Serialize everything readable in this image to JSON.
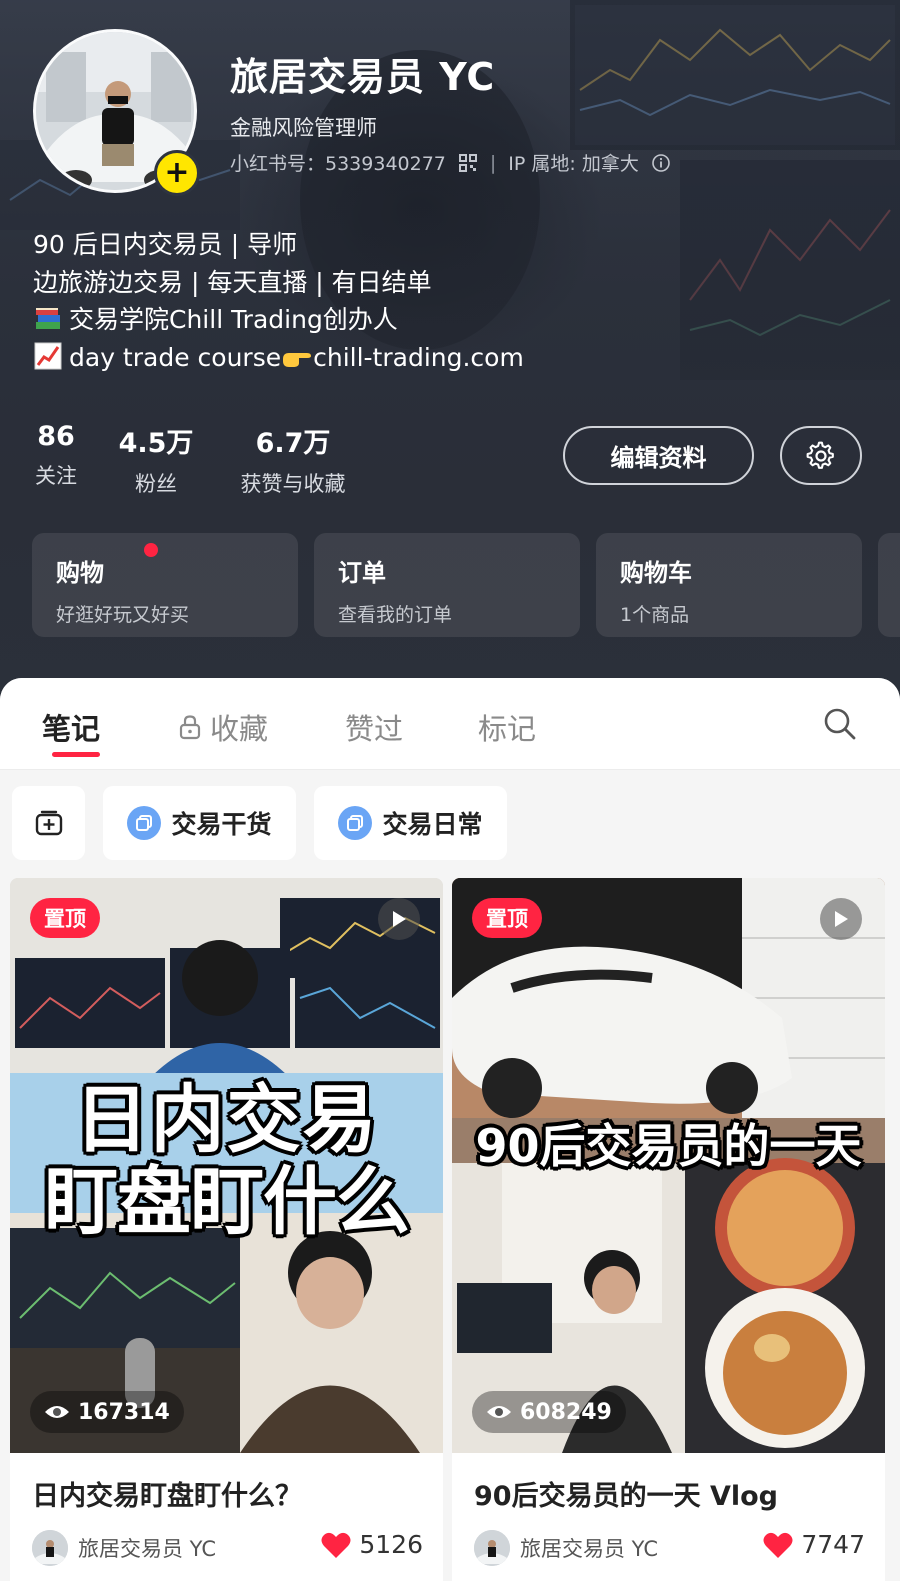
{
  "profile": {
    "nickname": "旅居交易员 YC",
    "title": "金融风险管理师",
    "id_text": "小红书号：5339340277",
    "ip_text": "IP 属地: 加拿大",
    "add_symbol": "+"
  },
  "bio": {
    "line1": "90 后日内交易员 | 导师",
    "line2": "边旅游边交易 | 每天直播 | 有日结单",
    "line3": "交易学院Chill Trading创办人",
    "line4a": "day trade course",
    "line4b": "chill-trading.com",
    "icons": [
      "books-emoji",
      "chart-increasing-emoji",
      "pointing-hand-emoji"
    ]
  },
  "stats": [
    {
      "num": "86",
      "label": "关注"
    },
    {
      "num": "4.5万",
      "label": "粉丝"
    },
    {
      "num": "6.7万",
      "label": "获赞与收藏"
    }
  ],
  "actions": {
    "edit_label": "编辑资料"
  },
  "cards": [
    {
      "title": "购物",
      "subtitle": "好逛好玩又好买",
      "has_dot": true
    },
    {
      "title": "订单",
      "subtitle": "查看我的订单"
    },
    {
      "title": "购物车",
      "subtitle": "1个商品"
    }
  ],
  "tabs": [
    {
      "label": "笔记",
      "active": true
    },
    {
      "label": "收藏",
      "locked": true
    },
    {
      "label": "赞过"
    },
    {
      "label": "标记"
    }
  ],
  "filters": [
    "交易干货",
    "交易日常"
  ],
  "notes": [
    {
      "pin": "置顶",
      "views": "167314",
      "overlay_line1": "日内交易",
      "overlay_line2": "盯盘盯什么",
      "title": "日内交易盯盘盯什么？",
      "author": "旅居交易员 YC",
      "likes": "5126"
    },
    {
      "pin": "置顶",
      "views": "608249",
      "overlay_line1": "90后交易员的一天",
      "title": "90后交易员的一天 Vlog",
      "author": "旅居交易员 YC",
      "likes": "7747"
    }
  ],
  "colors": {
    "accent": "#ff2442",
    "badge": "#ffe600",
    "header_bg": "#2e3440"
  }
}
